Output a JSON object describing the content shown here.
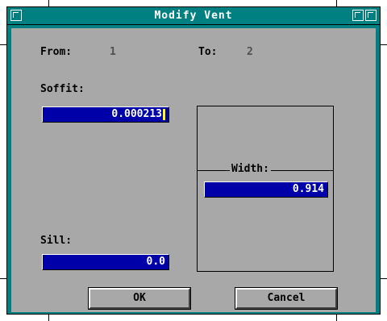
{
  "window": {
    "title": "Modify Vent"
  },
  "from": {
    "label": "From:",
    "value": "1"
  },
  "to": {
    "label": "To:",
    "value": "2"
  },
  "soffit": {
    "label": "Soffit:",
    "value": "0.000213"
  },
  "sill": {
    "label": "Sill:",
    "value": "0.0"
  },
  "width": {
    "label": "Width:",
    "value": "0.914"
  },
  "buttons": {
    "ok": "OK",
    "cancel": "Cancel"
  },
  "colors": {
    "titlebar": "#008080",
    "dialog_bg": "#a8a8a8",
    "field_bg": "#0000a8",
    "caret": "#ffff00"
  },
  "icons": {
    "system_menu": "system-menu-icon",
    "minimize": "minimize-icon",
    "maximize": "maximize-icon"
  }
}
